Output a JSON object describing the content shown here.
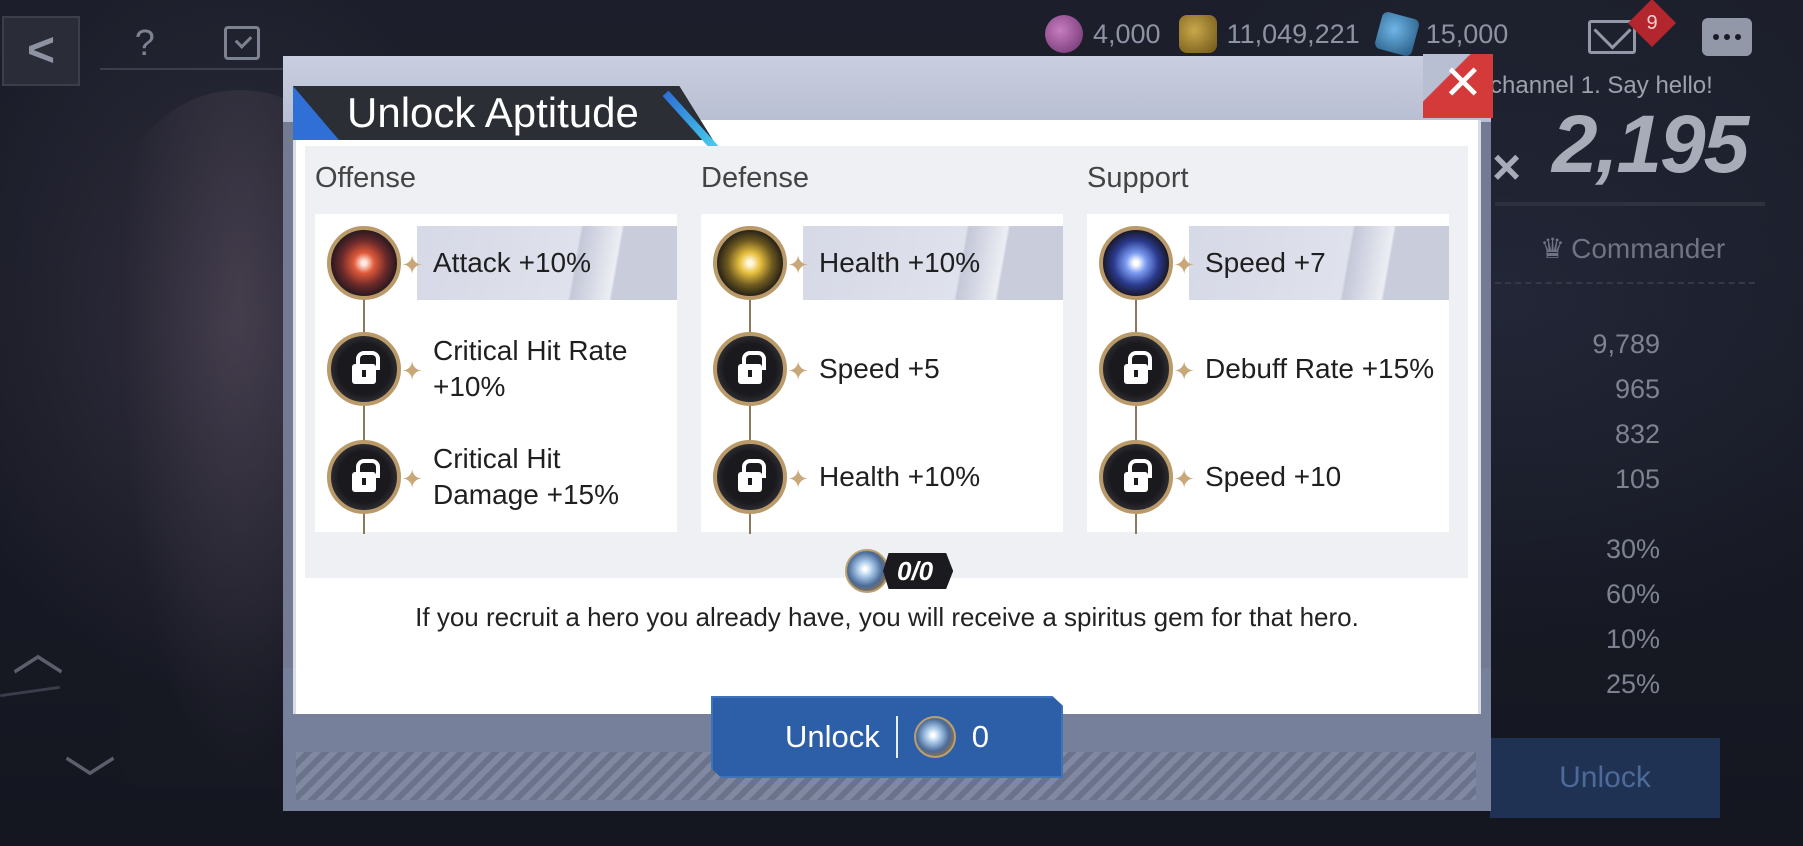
{
  "background": {
    "top_left": {
      "help_glyph": "?"
    },
    "currencies": [
      {
        "icon": "purple-gem-icon",
        "value": "4,000"
      },
      {
        "icon": "gold-coin-icon",
        "value": "11,049,221"
      },
      {
        "icon": "blue-crystal-icon",
        "value": "15,000"
      }
    ],
    "mail_badge": "9",
    "chat_message": "channel 1. Say hello!",
    "power_prefix": "×",
    "power_value": "2,195",
    "commander_label": "Commander",
    "stats_top": [
      "9,789",
      "965",
      "832",
      "105"
    ],
    "stats_bottom": [
      "30%",
      "60%",
      "10%",
      "25%"
    ],
    "unlock_label": "Unlock"
  },
  "modal": {
    "title": "Unlock Aptitude",
    "columns": [
      {
        "title": "Offense",
        "items": [
          {
            "label": "Attack +10%",
            "unlocked": true,
            "icon": "attack-orb-icon"
          },
          {
            "label": "Critical Hit Rate +10%",
            "unlocked": false,
            "icon": "lock-icon"
          },
          {
            "label": "Critical Hit Damage +15%",
            "unlocked": false,
            "icon": "lock-icon"
          }
        ]
      },
      {
        "title": "Defense",
        "items": [
          {
            "label": "Health +10%",
            "unlocked": true,
            "icon": "health-orb-icon"
          },
          {
            "label": "Speed +5",
            "unlocked": false,
            "icon": "lock-icon"
          },
          {
            "label": "Health +10%",
            "unlocked": false,
            "icon": "lock-icon"
          }
        ]
      },
      {
        "title": "Support",
        "items": [
          {
            "label": "Speed +7",
            "unlocked": true,
            "icon": "speed-orb-icon"
          },
          {
            "label": "Debuff Rate +15%",
            "unlocked": false,
            "icon": "lock-icon"
          },
          {
            "label": "Speed +10",
            "unlocked": false,
            "icon": "lock-icon"
          }
        ]
      }
    ],
    "gem_counter": "0/0",
    "info_text": "If you recruit a hero you already have, you will receive a spiritus gem for that hero.",
    "unlock_button": {
      "label": "Unlock",
      "cost": "0"
    },
    "colors": {
      "button": "#2d5ea8",
      "close": "#d43a3a",
      "title_accent": "#2f6fd6"
    }
  }
}
